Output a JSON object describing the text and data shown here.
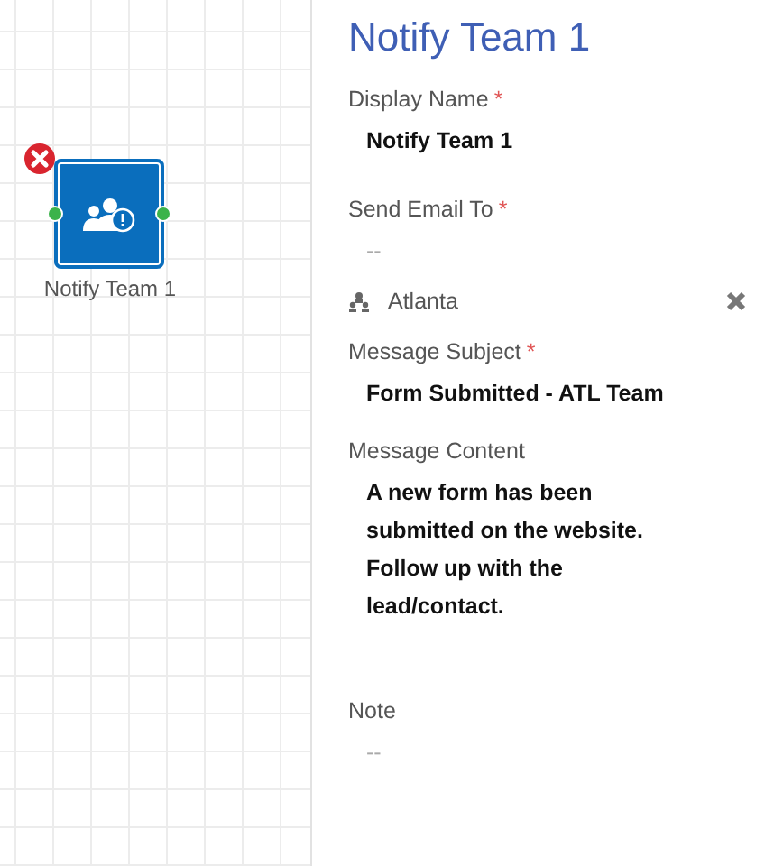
{
  "canvas": {
    "node": {
      "label": "Notify Team 1",
      "error": true
    }
  },
  "panel": {
    "title": "Notify Team 1",
    "fields": [
      {
        "kind": "text",
        "label": "Display Name",
        "required_mark": "*",
        "value": "Notify Team 1"
      },
      {
        "kind": "recipients",
        "label": "Send Email To",
        "required_mark": "*",
        "placeholder": "--",
        "recipients": [
          {
            "name": "Atlanta"
          }
        ]
      },
      {
        "kind": "text",
        "label": "Message Subject",
        "required_mark": "*",
        "value": "Form Submitted - ATL Team"
      },
      {
        "kind": "text",
        "label": "Message Content",
        "value": "A new form has been submitted on the website. Follow up with the lead/contact."
      },
      {
        "kind": "empty",
        "label": "Note",
        "placeholder": "--"
      }
    ]
  }
}
